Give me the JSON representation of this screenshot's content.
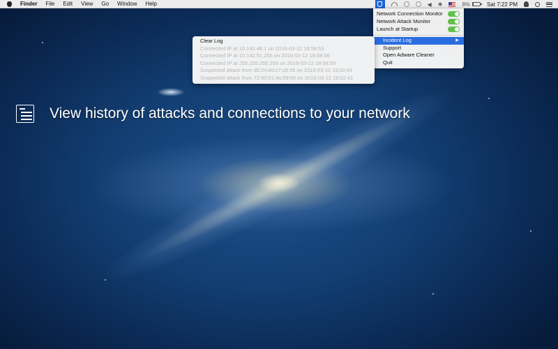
{
  "menubar": {
    "app_name": "Finder",
    "menus": [
      "File",
      "Edit",
      "View",
      "Go",
      "Window",
      "Help"
    ],
    "battery_percent": "8%",
    "battery_level": 0.08,
    "clock": "Sat 7:22 PM",
    "tray_icons": [
      "shield-app-icon",
      "wifi-icon",
      "circle-icon",
      "time-machine-icon",
      "volume-icon",
      "bluetooth-icon",
      "us-flag-icon",
      "battery-icon",
      "user-icon",
      "spotlight-search-icon",
      "notification-list-icon"
    ]
  },
  "status_menu": {
    "toggles": [
      {
        "label": "Network Connection Monitor",
        "on": true
      },
      {
        "label": "Network Attack Monitor",
        "on": true
      },
      {
        "label": "Launch at Startup",
        "on": true
      }
    ],
    "items": [
      "Incident Log",
      "Support",
      "Open Adware Cleaner",
      "Quit"
    ],
    "active_item": "Incident Log",
    "toggle_color": "#5fc14a",
    "highlight_color": "#2a6de0"
  },
  "incident_log": {
    "clear_label": "Clear Log",
    "entries": [
      "Connected IP at 10.142.48.1 on 2016-03-12 18:58:53",
      "Connected IP at 10.142.51.255 on 2016-03-12 18:58:56",
      "Connected IP at 255.255.255.255 on 2016-03-12 18:58:59",
      "Suspected attack from d0:24:80:c7:c6:26 on 2016-03-12 19:02:41",
      "Suspected attack from 72:00:01:4a:59:60 on 2016-03-12 19:02:41"
    ]
  },
  "caption": {
    "text": "View history of attacks and connections to your network",
    "icon": "log-list-icon"
  }
}
